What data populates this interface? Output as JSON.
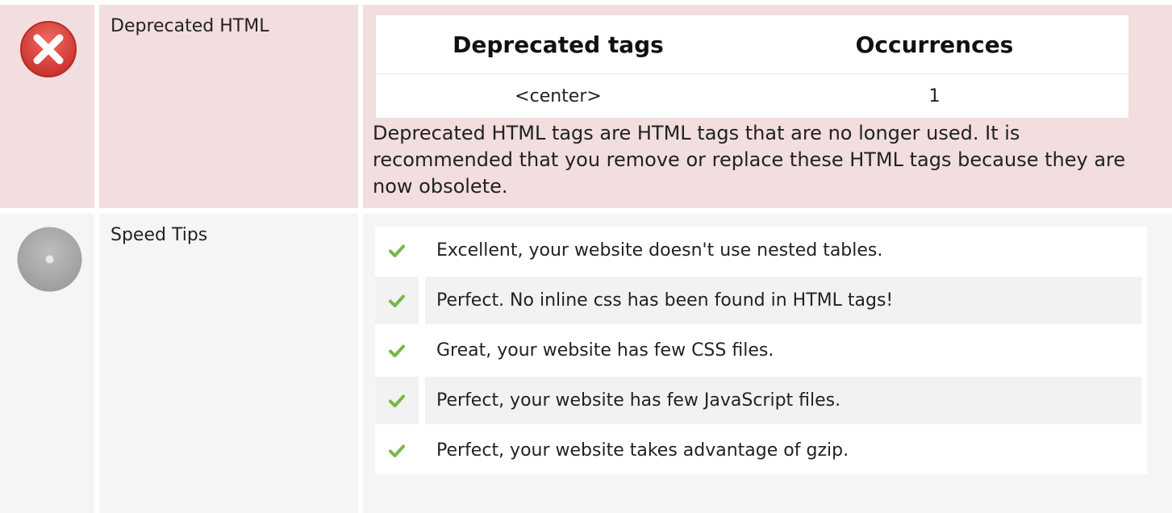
{
  "deprecated_html": {
    "label": "Deprecated HTML",
    "status_icon": "error-x-icon",
    "table": {
      "headers": [
        "Deprecated tags",
        "Occurrences"
      ],
      "rows": [
        {
          "tag": "<center>",
          "occurrences": "1"
        }
      ]
    },
    "description": "Deprecated HTML tags are HTML tags that are no longer used. It is recommended that you remove or replace these HTML tags because they are now obsolete."
  },
  "speed_tips": {
    "label": "Speed Tips",
    "status_icon": "neutral-circle-icon",
    "items": [
      {
        "text": "Excellent, your website doesn't use nested tables.",
        "icon": "check-icon"
      },
      {
        "text": "Perfect. No inline css has been found in HTML tags!",
        "icon": "check-icon"
      },
      {
        "text": "Great, your website has few CSS files.",
        "icon": "check-icon"
      },
      {
        "text": "Perfect, your website has few JavaScript files.",
        "icon": "check-icon"
      },
      {
        "text": "Perfect, your website takes advantage of gzip.",
        "icon": "check-icon"
      }
    ]
  },
  "colors": {
    "error_background": "#f2dede",
    "neutral_background": "#f5f5f5",
    "error_icon_red": "#d9534f",
    "neutral_icon_gray": "#aaaaaa",
    "check_green": "#7ab648"
  }
}
